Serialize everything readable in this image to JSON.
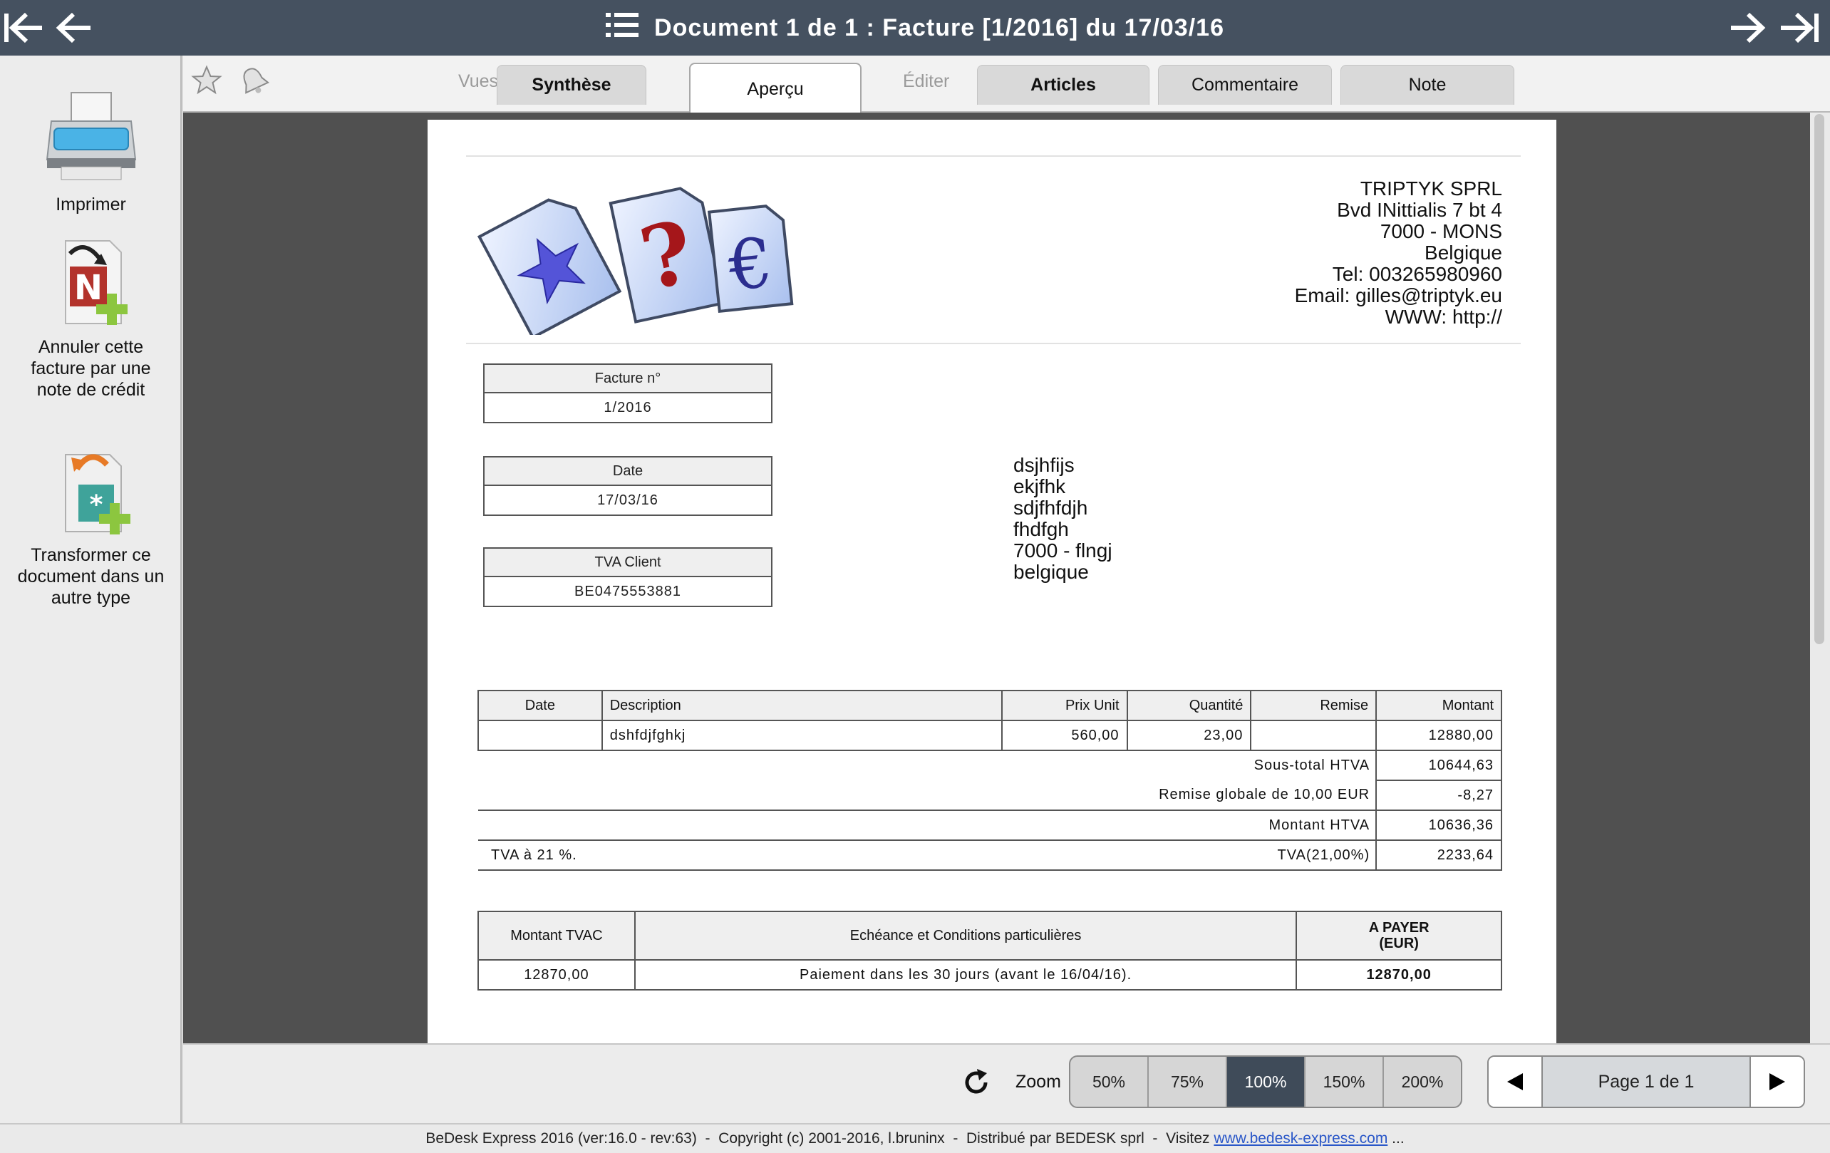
{
  "window": {
    "title": "Document 1 de 1  :  Facture [1/2016] du 17/03/16"
  },
  "sidebar": {
    "actions": [
      {
        "label": "Imprimer",
        "icon": "printer-icon"
      },
      {
        "label": "Annuler cette facture par une note de crédit",
        "icon": "credit-note-icon"
      },
      {
        "label": "Transformer ce document dans un autre type",
        "icon": "transform-document-icon"
      }
    ]
  },
  "tabs": {
    "group_views": "Vues",
    "group_edit": "Éditer",
    "items": [
      {
        "label": "Synthèse",
        "active": false
      },
      {
        "label": "Aperçu",
        "active": true
      },
      {
        "label": "Articles",
        "active": false
      },
      {
        "label": "Commentaire",
        "active": false
      },
      {
        "label": "Note",
        "active": false
      }
    ]
  },
  "invoice": {
    "company": {
      "name": "TRIPTYK SPRL",
      "address": "Bvd INittialis 7 bt 4",
      "city": "7000 - MONS",
      "country": "Belgique",
      "tel": "Tel: 003265980960",
      "email": "Email: gilles@triptyk.eu",
      "www": "WWW: http://"
    },
    "number_label": "Facture n°",
    "number": "1/2016",
    "date_label": "Date",
    "date": "17/03/16",
    "vat_label": "TVA Client",
    "vat": "BE0475553881",
    "client": [
      "dsjhfijs",
      "ekjfhk",
      "sdjfhfdjh",
      "fhdfgh",
      "7000 - flngj",
      "belgique"
    ],
    "lines_header": {
      "date": "Date",
      "description": "Description",
      "unit_price": "Prix Unit",
      "quantity": "Quantité",
      "discount": "Remise",
      "amount": "Montant"
    },
    "lines": [
      {
        "date": "",
        "description": "dshfdjfghkj",
        "unit_price": "560,00",
        "quantity": "23,00",
        "discount": "",
        "amount": "12880,00"
      }
    ],
    "totals": {
      "subtotal_label": "Sous-total HTVA",
      "subtotal": "10644,63",
      "global_discount_label": "Remise globale de 10,00 EUR",
      "global_discount": "-8,27",
      "net_label": "Montant HTVA",
      "net": "10636,36",
      "vat_note": "TVA à 21 %.",
      "vat_label": "TVA(21,00%)",
      "vat_amount": "2233,64"
    },
    "summary": {
      "tvac_label": "Montant TVAC",
      "terms_label": "Echéance et Conditions particulières",
      "pay_label": "A PAYER",
      "pay_unit": "(EUR)",
      "tvac": "12870,00",
      "terms": "Paiement dans les 30 jours (avant le 16/04/16).",
      "pay": "12870,00"
    }
  },
  "bottom": {
    "zoom_label": "Zoom",
    "zoom_levels": [
      "50%",
      "75%",
      "100%",
      "150%",
      "200%"
    ],
    "zoom_selected": "100%",
    "page_label": "Page 1 de 1"
  },
  "status": {
    "text": "BeDesk Express 2016 (ver:16.0 - rev:63)  -  Copyright (c) 2001-2016, l.bruninx  -  Distribué par BEDESK sprl  -  Visitez ",
    "link": "www.bedesk-express.com",
    "tail": " ..."
  },
  "colors": {
    "titlebar": "#455160",
    "zoom_selected": "#3f4b59",
    "preview_bg": "#505050"
  }
}
